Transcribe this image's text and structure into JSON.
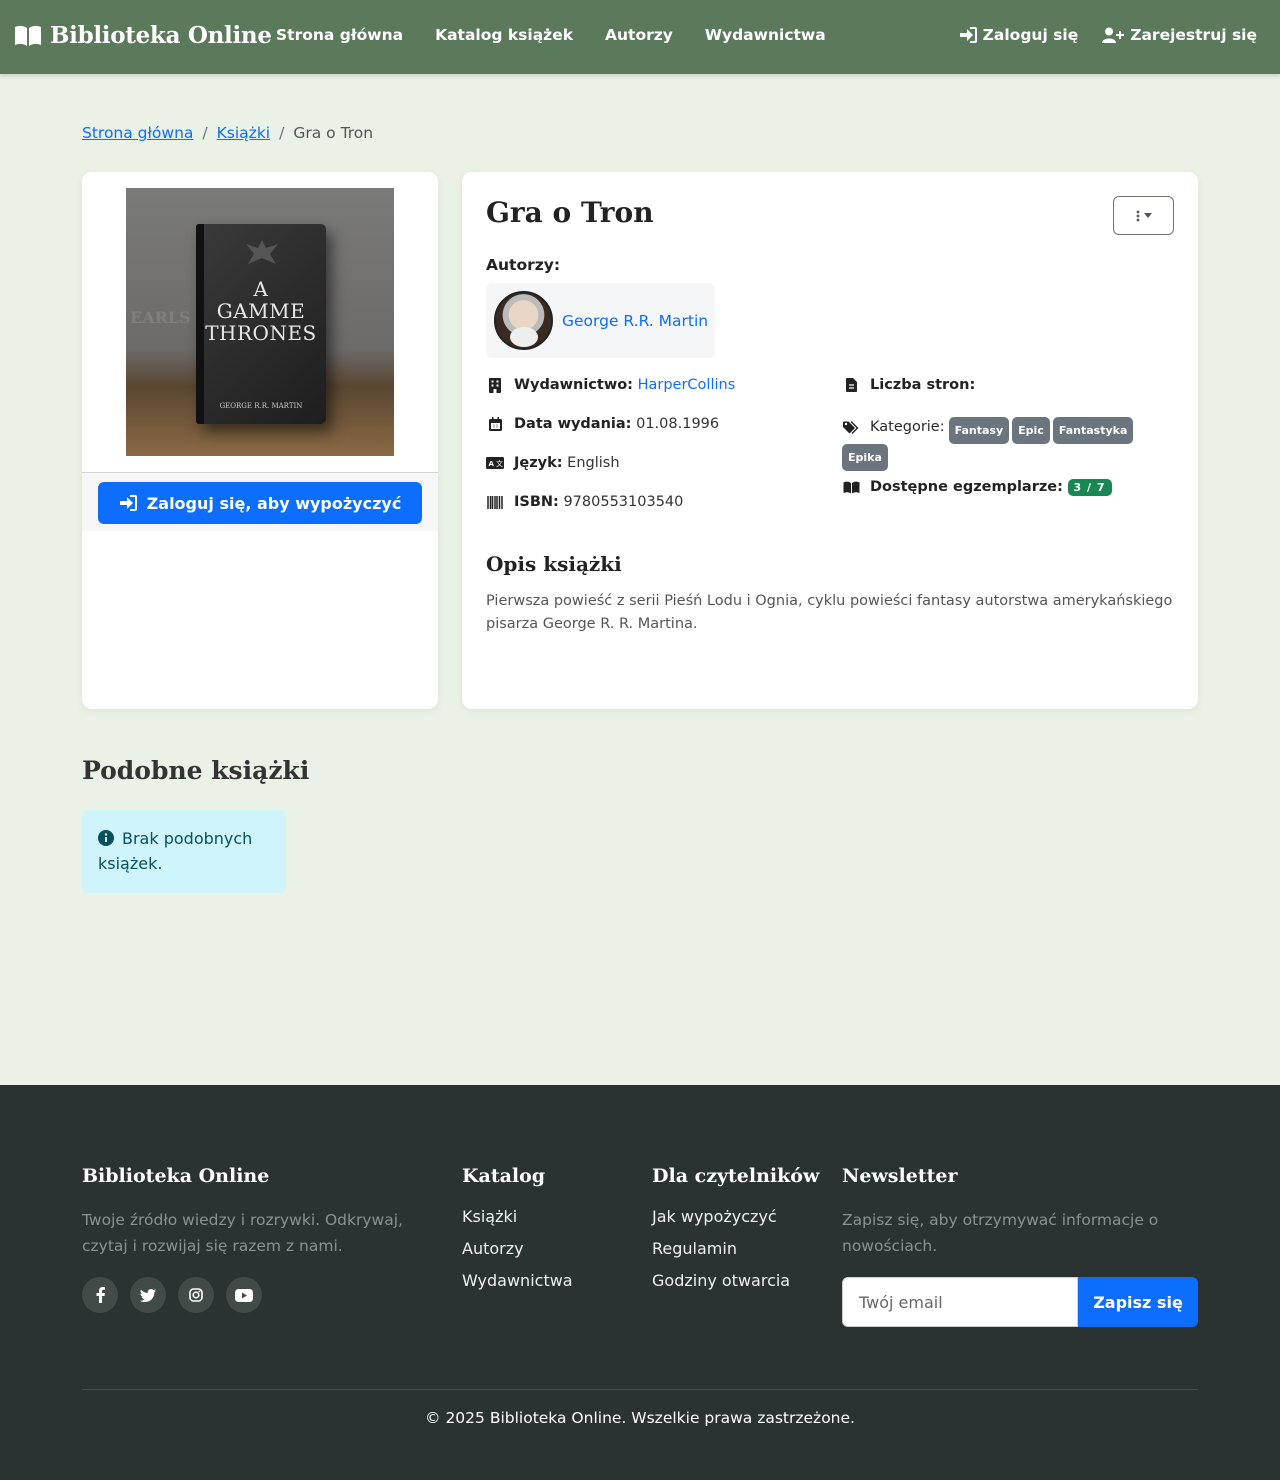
{
  "navbar": {
    "brand": "Biblioteka Online",
    "links": [
      "Strona główna",
      "Katalog książek",
      "Autorzy",
      "Wydawnictwa"
    ],
    "login": "Zaloguj się",
    "register": "Zarejestruj się"
  },
  "breadcrumb": {
    "home": "Strona główna",
    "books": "Książki",
    "current": "Gra o Tron"
  },
  "book": {
    "title": "Gra o Tron",
    "borrow_button": "Zaloguj się, aby wypożyczyć",
    "authors_label": "Autorzy:",
    "author_name": "George R.R. Martin",
    "publisher_label": "Wydawnictwo:",
    "publisher": "HarperCollins",
    "date_label": "Data wydania:",
    "date": "01.08.1996",
    "language_label": "Język:",
    "language": "English",
    "isbn_label": "ISBN:",
    "isbn": "9780553103540",
    "pages_label": "Liczba stron:",
    "categories_label": "Kategorie:",
    "categories": [
      "Fantasy",
      "Epic",
      "Fantastyka",
      "Epika"
    ],
    "copies_label": "Dostępne egzemplarze:",
    "copies": "3 / 7",
    "description_heading": "Opis książki",
    "description": "Pierwsza powieść z serii Pieśń Lodu i Ognia, cyklu powieści fantasy autorstwa amerykańskiego pisarza George R. R. Martina."
  },
  "similar": {
    "heading": "Podobne książki",
    "empty_message": "Brak podobnych książek."
  },
  "footer": {
    "about_heading": "Biblioteka Online",
    "about_text": "Twoje źródło wiedzy i rozrywki. Odkrywaj, czytaj i rozwijaj się razem z nami.",
    "catalog_heading": "Katalog",
    "catalog_links": [
      "Książki",
      "Autorzy",
      "Wydawnictwa"
    ],
    "readers_heading": "Dla czytelników",
    "readers_links": [
      "Jak wypożyczyć",
      "Regulamin",
      "Godziny otwarcia"
    ],
    "newsletter_heading": "Newsletter",
    "newsletter_text": "Zapisz się, aby otrzymywać informacje o nowościach.",
    "email_placeholder": "Twój email",
    "subscribe": "Zapisz się",
    "copyright": "© 2025 Biblioteka Online. Wszelkie prawa zastrzeżone."
  },
  "colors": {
    "navbar": "#5b7a5b",
    "page_bg": "#eaf1e7",
    "primary": "#0d6efd",
    "footer_bg": "#2b3332",
    "success": "#198754"
  }
}
